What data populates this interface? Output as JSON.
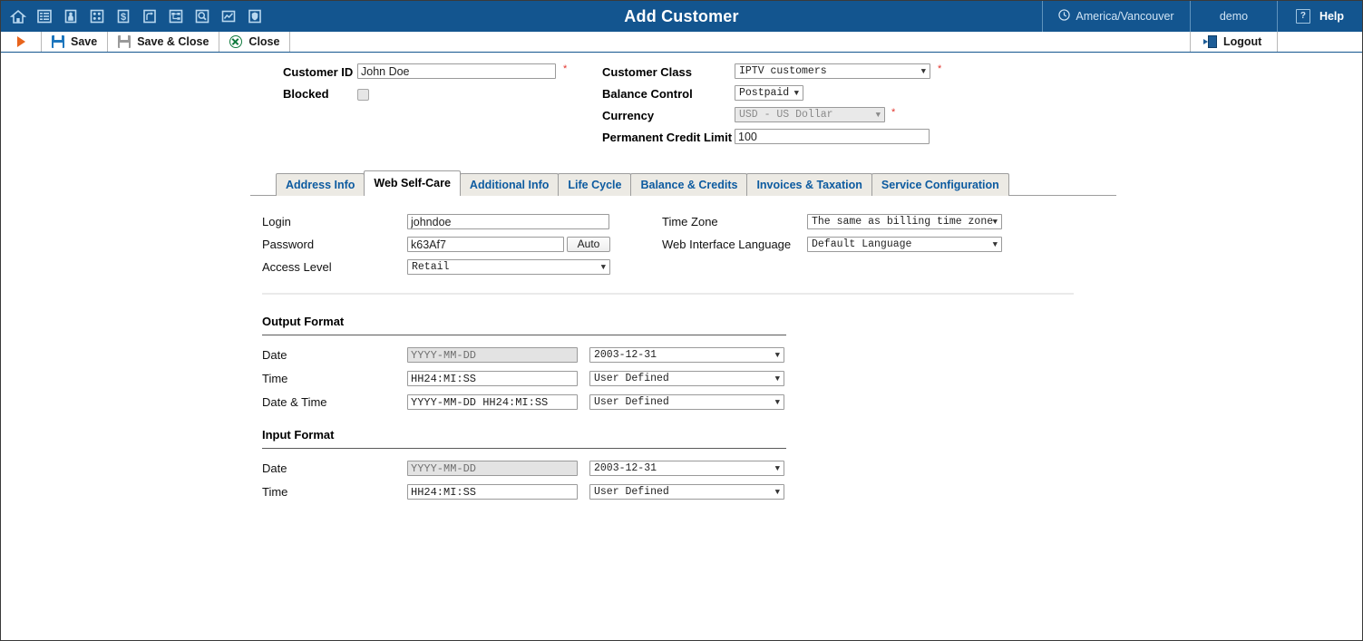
{
  "window": {
    "title": "Add Customer"
  },
  "topbar": {
    "icons": [
      {
        "name": "home-icon"
      },
      {
        "name": "list-icon"
      },
      {
        "name": "person-icon"
      },
      {
        "name": "keypad-icon"
      },
      {
        "name": "dollar-icon"
      },
      {
        "name": "routing-icon"
      },
      {
        "name": "sitemap-icon"
      },
      {
        "name": "search-icon"
      },
      {
        "name": "chart-icon"
      },
      {
        "name": "shield-icon"
      }
    ],
    "timezone": "America/Vancouver",
    "user": "demo",
    "help": "Help",
    "help_icon": "question-icon",
    "clock_icon": "clock-icon",
    "bg_color": "#13558f"
  },
  "toolbar": {
    "run_icon": "play-triangle-icon",
    "save_label": "Save",
    "save_close_label": "Save & Close",
    "close_label": "Close",
    "logout_label": "Logout",
    "save_icon": "floppy-icon",
    "save_close_icon": "floppy-disabled-icon",
    "close_icon": "close-circle-icon",
    "logout_icon": "logout-icon"
  },
  "header_form": {
    "customer_id": {
      "label": "Customer ID",
      "value": "John Doe",
      "required": "*"
    },
    "blocked": {
      "label": "Blocked",
      "checked": false
    },
    "customer_class": {
      "label": "Customer Class",
      "value": "IPTV customers",
      "required": "*"
    },
    "balance_control": {
      "label": "Balance Control",
      "value": "Postpaid"
    },
    "currency": {
      "label": "Currency",
      "value": "USD - US Dollar",
      "required": "*",
      "disabled": true
    },
    "credit_limit": {
      "label": "Permanent Credit Limit",
      "value": "100"
    }
  },
  "tabs": [
    {
      "label": "Address Info",
      "active": false
    },
    {
      "label": "Web Self-Care",
      "active": true
    },
    {
      "label": "Additional Info",
      "active": false
    },
    {
      "label": "Life Cycle",
      "active": false
    },
    {
      "label": "Balance & Credits",
      "active": false
    },
    {
      "label": "Invoices & Taxation",
      "active": false
    },
    {
      "label": "Service Configuration",
      "active": false
    }
  ],
  "web_self_care": {
    "login": {
      "label": "Login",
      "value": "johndoe"
    },
    "password": {
      "label": "Password",
      "value": "k63Af7",
      "auto_label": "Auto"
    },
    "access_level": {
      "label": "Access Level",
      "value": "Retail"
    },
    "time_zone": {
      "label": "Time Zone",
      "value": "The same as billing time zone"
    },
    "web_language": {
      "label": "Web Interface Language",
      "value": "Default Language"
    }
  },
  "output_format": {
    "title": "Output Format",
    "rows": [
      {
        "label": "Date",
        "pattern": "YYYY-MM-DD",
        "pattern_disabled": true,
        "preset": "2003-12-31"
      },
      {
        "label": "Time",
        "pattern": "HH24:MI:SS",
        "pattern_disabled": false,
        "preset": "User Defined"
      },
      {
        "label": "Date & Time",
        "pattern": "YYYY-MM-DD HH24:MI:SS",
        "pattern_disabled": false,
        "preset": "User Defined"
      }
    ]
  },
  "input_format": {
    "title": "Input Format",
    "rows": [
      {
        "label": "Date",
        "pattern": "YYYY-MM-DD",
        "pattern_disabled": true,
        "preset": "2003-12-31"
      },
      {
        "label": "Time",
        "pattern": "HH24:MI:SS",
        "pattern_disabled": false,
        "preset": "User Defined"
      }
    ]
  }
}
